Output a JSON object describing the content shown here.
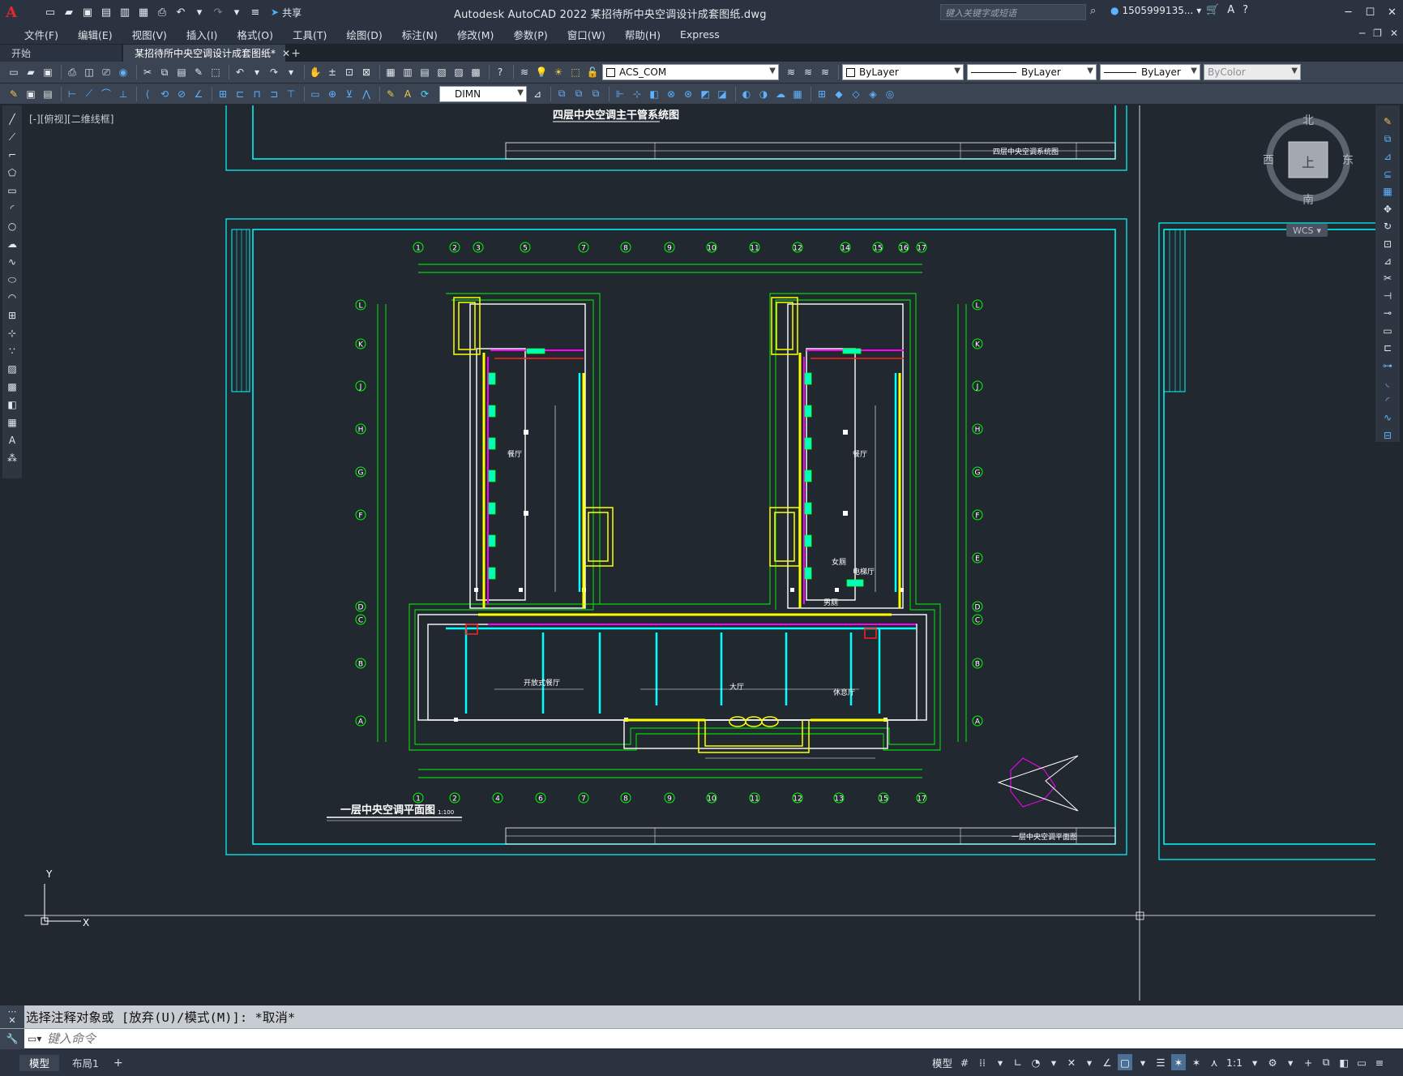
{
  "app": {
    "logo": "A",
    "window_title": "Autodesk AutoCAD 2022    某招待所中央空调设计成套图纸.dwg",
    "share_label": "共享",
    "search_placeholder": "键入关键字或短语",
    "user_name": "1505999135..."
  },
  "menu": [
    "文件(F)",
    "编辑(E)",
    "视图(V)",
    "插入(I)",
    "格式(O)",
    "工具(T)",
    "绘图(D)",
    "标注(N)",
    "修改(M)",
    "参数(P)",
    "窗口(W)",
    "帮助(H)",
    "Express"
  ],
  "tabs": {
    "start": "开始",
    "active": "某招待所中央空调设计成套图纸*",
    "close": "✕",
    "add": "+"
  },
  "toolbar": {
    "layer_combo": "ACS_COM",
    "color_combo": "ByLayer",
    "linetype_combo": "ByLayer",
    "lineweight_combo": "ByLayer",
    "plotstyle_combo": "ByColor",
    "dimstyle_combo": "DIMN"
  },
  "viewport": {
    "label": "[-][俯视][二维线框]",
    "drawing_top_title": "四层中央空调主干管系统图",
    "drawing_main_title": "一层中央空调平面图",
    "main_scale": "1:100",
    "title_block_top": "四层中央空调系统图",
    "title_block_main": "一层中央空调平面图",
    "room_left": "餐厅",
    "room_right": "餐厅",
    "room_hall": "大厅",
    "room_open": "开放式餐厅",
    "room_rest": "休息厅",
    "room_elevator": "电梯厅",
    "room_wc": "女厕",
    "room_wc2": "男厕",
    "axis_top": [
      "1",
      "2",
      "3",
      "5",
      "7",
      "8",
      "9",
      "10",
      "11",
      "12",
      "14",
      "15",
      "16",
      "17"
    ],
    "axis_bottom": [
      "1",
      "2",
      "4",
      "6",
      "7",
      "8",
      "9",
      "10",
      "11",
      "12",
      "13",
      "15",
      "17"
    ],
    "axis_left": [
      "L",
      "K",
      "J",
      "H",
      "G",
      "F",
      "D",
      "C",
      "B",
      "A"
    ],
    "axis_right": [
      "L",
      "K",
      "J",
      "H",
      "G",
      "F",
      "E",
      "D",
      "C",
      "B",
      "A"
    ],
    "ucs_x": "X",
    "ucs_y": "Y"
  },
  "viewcube": {
    "north": "北",
    "south": "南",
    "east": "东",
    "west": "西",
    "face": "上",
    "wcs": "WCS"
  },
  "command": {
    "history": "选择注释对象或 [放弃(U)/模式(M)]: *取消*",
    "placeholder": "键入命令"
  },
  "status": {
    "model_tab": "模型",
    "layout_tab": "布局1",
    "add": "+",
    "model_label": "模型",
    "scale": "1:1"
  },
  "colors": {
    "accent": "#4c6f96",
    "frame": "#00ffff",
    "grid": "#00ff00",
    "wall": "#ffffff",
    "duct_yellow": "#ffff00",
    "pipe_magenta": "#ff00ff",
    "pipe_red": "#ff2020"
  }
}
